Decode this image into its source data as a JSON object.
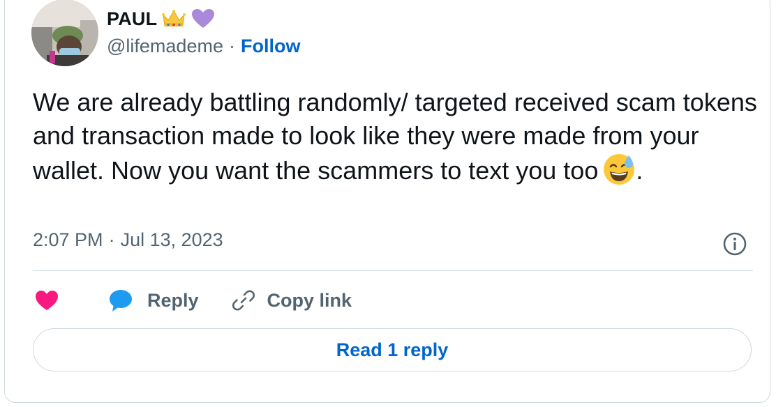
{
  "author": {
    "name": "PAUL",
    "handle": "@lifemademe",
    "separator": "·",
    "follow_label": "Follow",
    "badges": [
      "crown-emoji",
      "purple-heart-emoji"
    ]
  },
  "tweet": {
    "text": "We are already battling randomly/ targeted received scam tokens and transaction made to look like they were made from your wallet. Now you want the scammers to text you too",
    "text_suffix": ".",
    "emoji": "grinning-face-with-sweat-emoji",
    "time": "2:07 PM",
    "separator": "·",
    "date": "Jul 13, 2023"
  },
  "actions": {
    "like_icon": "heart-icon",
    "reply_label": "Reply",
    "copy_link_label": "Copy link"
  },
  "read_replies_label": "Read 1 reply",
  "colors": {
    "link": "#0066cc",
    "muted": "#536471",
    "like": "#f91880",
    "reply_bubble": "#1d9bf0",
    "border": "#cfd9de"
  }
}
